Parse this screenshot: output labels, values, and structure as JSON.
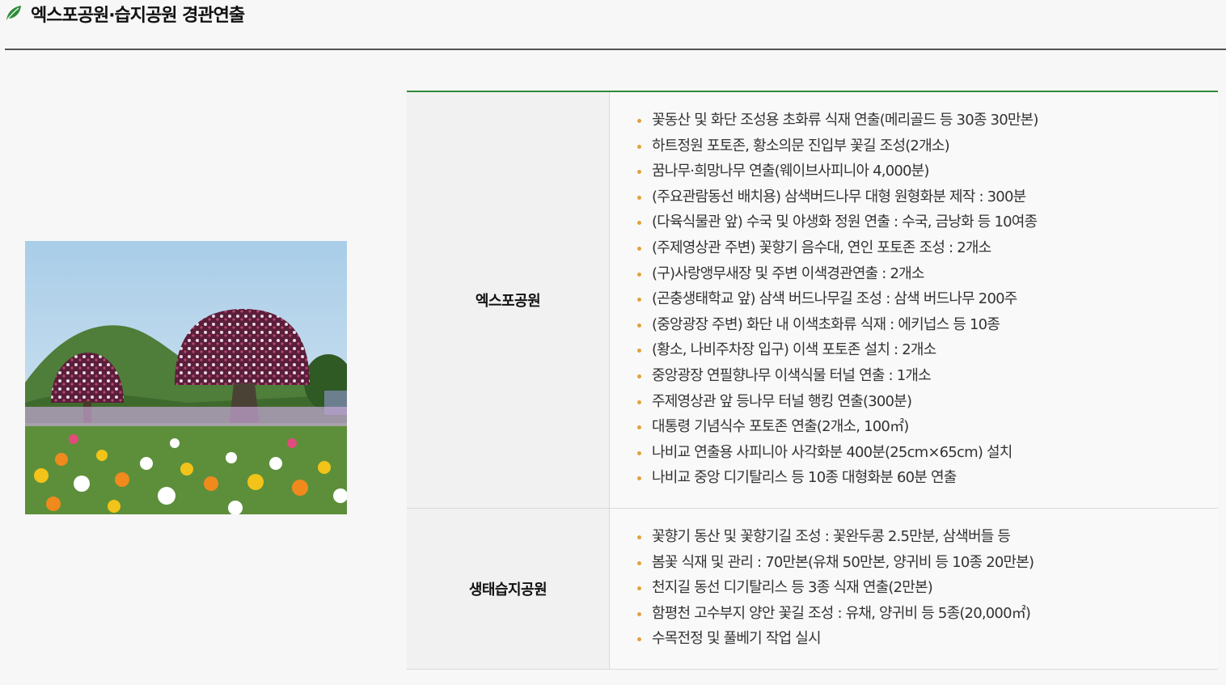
{
  "section": {
    "title": "엑스포공원·습지공원 경관연출",
    "icon": "leaf-icon",
    "accent_color": "#2e8b3a"
  },
  "photo": {
    "alt": "flower-dome-sculpture-photo"
  },
  "table": {
    "rows": [
      {
        "heading": "엑스포공원",
        "items": [
          "꽃동산 및 화단 조성용 초화류 식재 연출(메리골드 등 30종 30만본)",
          "하트정원 포토존, 황소의문 진입부 꽃길 조성(2개소)",
          "꿈나무·희망나무 연출(웨이브사피니아 4,000분)",
          "(주요관람동선 배치용) 삼색버드나무 대형 원형화분 제작 : 300분",
          "(다육식물관 앞) 수국 및 야생화 정원 연출 : 수국, 금낭화 등 10여종",
          "(주제영상관 주변) 꽃향기 음수대, 연인 포토존 조성 : 2개소",
          "(구)사랑앵무새장 및 주변 이색경관연출 : 2개소",
          "(곤충생태학교 앞) 삼색 버드나무길 조성 : 삼색 버드나무 200주",
          "(중앙광장 주변) 화단 내 이색초화류 식재 : 에키넙스 등 10종",
          "(황소, 나비주차장 입구) 이색 포토존 설치 : 2개소",
          "중앙광장 연필향나무 이색식물 터널 연출 : 1개소",
          "주제영상관 앞 등나무 터널 행킹 연출(300분)",
          "대통령 기념식수 포토존 연출(2개소, 100㎡)",
          "나비교 연출용 사피니아 사각화분 400분(25cm×65cm) 설치",
          "나비교 중앙 디기탈리스 등 10종 대형화분 60분 연출"
        ]
      },
      {
        "heading": "생태습지공원",
        "items": [
          "꽃향기 동산 및 꽃향기길 조성 : 꽃완두콩 2.5만분, 삼색버들 등",
          "봄꽃 식재 및 관리 : 70만본(유채 50만본, 양귀비 등 10종 20만본)",
          "천지길 동선 디기탈리스 등 3종 식재 연출(2만본)",
          "함평천 고수부지 양안 꽃길 조성 : 유채, 양귀비 등 5종(20,000㎡)",
          "수목전정 및 풀베기 작업 실시"
        ]
      }
    ]
  }
}
